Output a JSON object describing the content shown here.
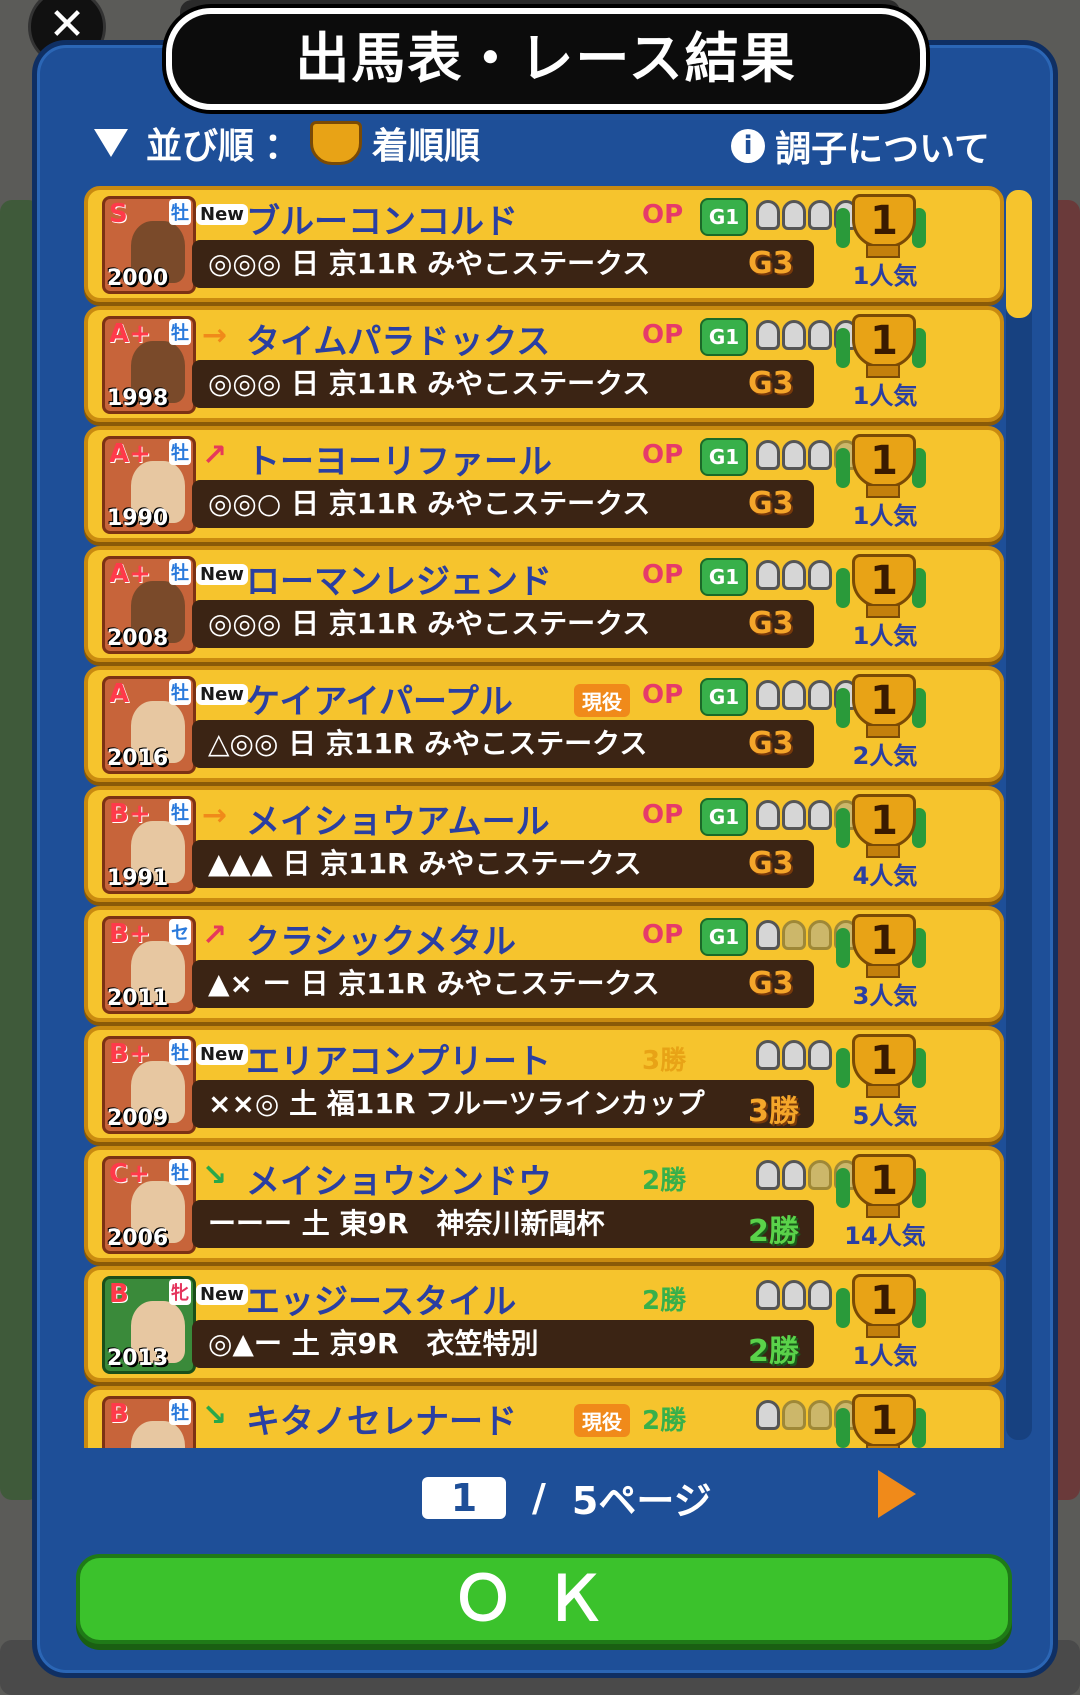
{
  "title": "出馬表・レース結果",
  "sort": {
    "label": "並び順",
    "separator": "：",
    "value": "着順順"
  },
  "info_label": "調子について",
  "rows": [
    {
      "rank": "S",
      "sex": "牡",
      "year": "2000",
      "tag": "New",
      "name": "ブルーコンコルド",
      "current": "",
      "class": "OP",
      "g1": true,
      "shoes": 5,
      "shoes_dim": 0,
      "detail": "◎◎◎ 日 京11R みやこステークス",
      "grade": "G3",
      "place": "1",
      "pop": "1人気"
    },
    {
      "rank": "A+",
      "sex": "牡",
      "year": "1998",
      "tag": "→",
      "name": "タイムパラドックス",
      "current": "",
      "class": "OP",
      "g1": true,
      "shoes": 5,
      "shoes_dim": 0,
      "detail": "◎◎◎ 日 京11R みやこステークス",
      "grade": "G3",
      "place": "1",
      "pop": "1人気"
    },
    {
      "rank": "A+",
      "sex": "牡",
      "year": "1990",
      "tag": "↗",
      "name": "トーヨーリファール",
      "current": "",
      "class": "OP",
      "g1": true,
      "shoes": 3,
      "shoes_dim": 1,
      "detail": "◎◎○ 日 京11R みやこステークス",
      "grade": "G3",
      "place": "1",
      "pop": "1人気"
    },
    {
      "rank": "A+",
      "sex": "牡",
      "year": "2008",
      "tag": "New",
      "name": "ローマンレジェンド",
      "current": "",
      "class": "OP",
      "g1": true,
      "shoes": 3,
      "shoes_dim": 0,
      "detail": "◎◎◎ 日 京11R みやこステークス",
      "grade": "G3",
      "place": "1",
      "pop": "1人気"
    },
    {
      "rank": "A",
      "sex": "牡",
      "year": "2016",
      "tag": "New",
      "name": "ケイアイパープル",
      "current": "現役",
      "class": "OP",
      "g1": true,
      "shoes": 5,
      "shoes_dim": 0,
      "detail": "△◎◎ 日 京11R みやこステークス",
      "grade": "G3",
      "place": "1",
      "pop": "2人気"
    },
    {
      "rank": "B+",
      "sex": "牡",
      "year": "1991",
      "tag": "→",
      "name": "メイショウアムール",
      "current": "",
      "class": "OP",
      "g1": true,
      "shoes": 3,
      "shoes_dim": 2,
      "detail": "▲▲▲ 日 京11R みやこステークス",
      "grade": "G3",
      "place": "1",
      "pop": "4人気"
    },
    {
      "rank": "B+",
      "sex": "セ",
      "year": "2011",
      "tag": "↗",
      "name": "クラシックメタル",
      "current": "",
      "class": "OP",
      "g1": true,
      "shoes": 1,
      "shoes_dim": 3,
      "detail": "▲× ー 日 京11R みやこステークス",
      "grade": "G3",
      "place": "1",
      "pop": "3人気"
    },
    {
      "rank": "B+",
      "sex": "牡",
      "year": "2009",
      "tag": "New",
      "name": "エリアコンプリート",
      "current": "",
      "class": "3勝",
      "g1": false,
      "shoes": 3,
      "shoes_dim": 0,
      "detail": "××◎ 土 福11R フルーツラインカップ",
      "grade": "3勝",
      "place": "1",
      "pop": "5人気"
    },
    {
      "rank": "C+",
      "sex": "牡",
      "year": "2006",
      "tag": "↘",
      "name": "メイショウシンドウ",
      "current": "",
      "class": "2勝",
      "g1": false,
      "shoes": 2,
      "shoes_dim": 2,
      "detail": "ーーー 土 東9R　神奈川新聞杯",
      "grade": "2勝",
      "place": "1",
      "pop": "14人気"
    },
    {
      "rank": "B",
      "sex": "牝",
      "year": "2013",
      "tag": "New",
      "name": "エッジースタイル",
      "current": "",
      "class": "2勝",
      "g1": false,
      "shoes": 3,
      "shoes_dim": 0,
      "detail": "◎▲ー 土 京9R　衣笠特別",
      "grade": "2勝",
      "place": "1",
      "pop": "1人気"
    },
    {
      "rank": "B",
      "sex": "牡",
      "year": "",
      "tag": "↘",
      "name": "キタノセレナード",
      "current": "現役",
      "class": "2勝",
      "g1": false,
      "shoes": 1,
      "shoes_dim": 3,
      "detail": "",
      "grade": "",
      "place": "1",
      "pop": ""
    }
  ],
  "pager": {
    "current": "1",
    "separator": "/",
    "total": "5ページ"
  },
  "ok_label": "ＯＫ",
  "colors": {
    "panel": "#1e4f98",
    "row": "#f6c42d",
    "ok": "#3bc22c",
    "name": "#2a3fa2"
  }
}
